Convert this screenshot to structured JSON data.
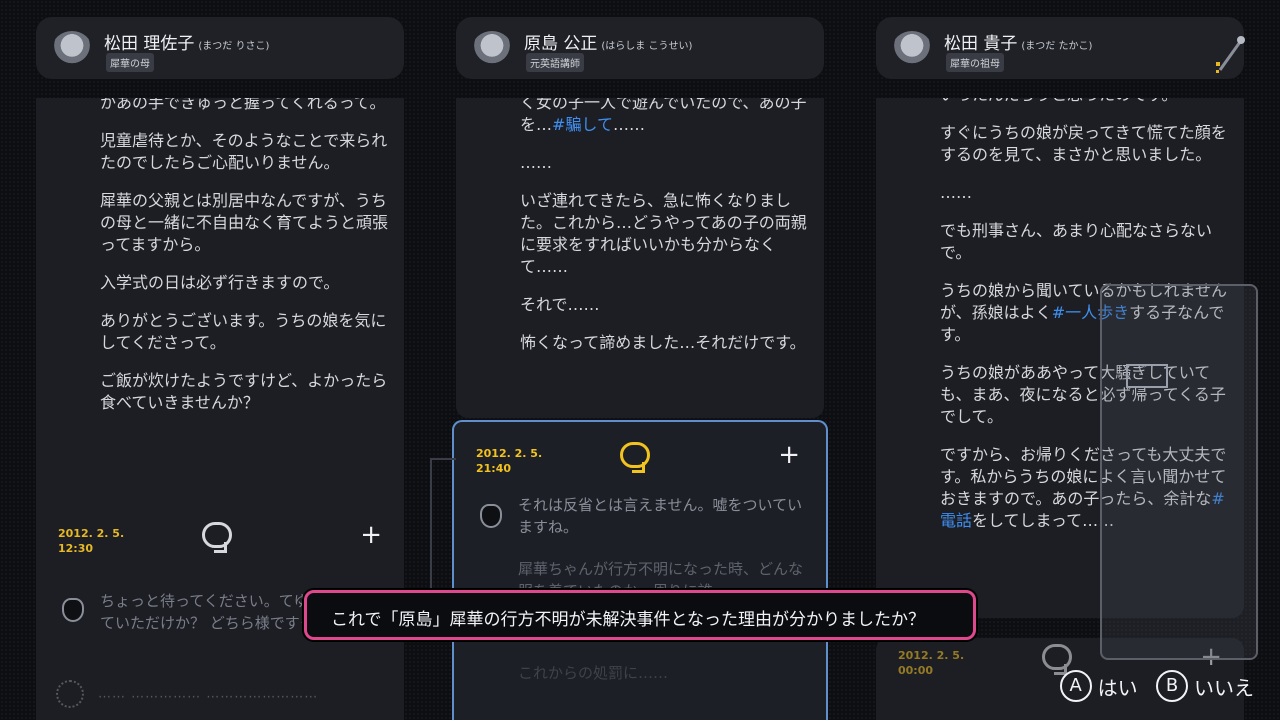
{
  "columns": [
    {
      "name": "松田 理佐子",
      "kana": "(まつだ りさこ)",
      "role": "犀華の母",
      "messages": [
        "かあの手できゅっと握ってくれるって。",
        "児童虐待とか、そのようなことで来られたのでしたらご心配いりません。",
        "犀華の父親とは別居中なんですが、うちの母と一緒に不自由なく育てようと頑張ってますから。",
        "入学式の日は必ず行きますので。",
        "ありがとうございます。うちの娘を気にしてくださって。",
        "ご飯が炊けたようですけど、よかったら食べていきませんか？"
      ],
      "note": {
        "date": "2012. 2. 5.\n12:30",
        "text": "ちょっと待ってください。てゆっくり話していただけか？ どちら様ですって？"
      }
    },
    {
      "name": "原島 公正",
      "kana": "(はらしま こうせい)",
      "role": "元英語講師",
      "msg0_pre": "く女の子一人で遊んでいたので、あの子を…",
      "msg0_tag": "#騙して",
      "msg0_post": "……",
      "messages": [
        "……",
        "いざ連れてきたら、急に怖くなりました。これから…どうやってあの子の両親に要求をすればいいかも分からなくて……",
        "それで……",
        "怖くなって諦めました…それだけです。"
      ],
      "note": {
        "date": "2012. 2. 5.\n21:40",
        "text1": "それは反省とは言えません。嘘をついていますね。",
        "text2": "犀華ちゃんが行方不明になった時、どんな服を着ていたのか、周りに誰",
        "text3": "これからの処罰に……"
      }
    },
    {
      "name": "松田 貴子",
      "kana": "(まつだ たかこ)",
      "role": "犀華の祖母",
      "messages": [
        "いったんだろうと思ったのです。",
        "すぐにうちの娘が戻ってきて慌てた顔をするのを見て、まさかと思いました。",
        "……",
        "でも刑事さん、あまり心配なさらないで。"
      ],
      "m4_pre": "うちの娘から聞いているかもしれませんが、孫娘はよく",
      "m4_tag": "#一人歩き",
      "m4_post": "する子なんです。",
      "m5": "うちの娘がああやって大騒ぎしていても、まあ、夜になると必ず帰ってくる子でして。",
      "m6_pre": "ですから、お帰りくださっても大丈夫です。私からうちの娘によく言い聞かせておきますので。あの子ったら、余計な",
      "m6_tag": "#電話",
      "m6_post": "をしてしまって……",
      "note": {
        "date": "2012. 2. 5.\n00:00"
      }
    }
  ],
  "dialog": {
    "question": "これで「原島」犀華の行方不明が未解決事件となった理由が分かりましたか？"
  },
  "buttons": {
    "a_key": "A",
    "a_label": "はい",
    "b_key": "B",
    "b_label": "いいえ"
  },
  "bottom": {
    "text": "…… …………… ……………………"
  },
  "icons": {
    "bubble": "speech-bubble-icon",
    "plus": "plus-icon",
    "police": "police-badge-icon"
  },
  "colors": {
    "date": "#e6b826",
    "tag": "#3f8ff0",
    "dialog_border": "#e0488e",
    "selected_border": "#5f90cc"
  }
}
